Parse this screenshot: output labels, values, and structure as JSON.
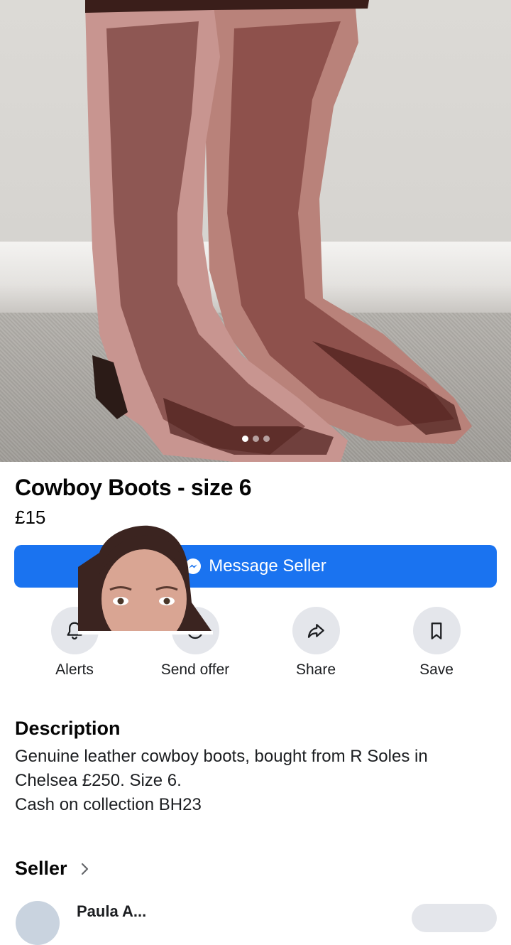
{
  "listing": {
    "title": "Cowboy Boots - size 6",
    "price": "£15"
  },
  "carousel": {
    "image_count": 3,
    "active_index": 0,
    "image_subject": "pair of pink and brown leather cowboy boots with eagle design"
  },
  "primary_action": {
    "label": "Message Seller",
    "icon": "messenger-icon",
    "color": "#1a73f0"
  },
  "actions": [
    {
      "label": "Alerts",
      "icon": "bell-icon"
    },
    {
      "label": "Send offer",
      "icon": "offer-icon"
    },
    {
      "label": "Share",
      "icon": "share-arrow-icon"
    },
    {
      "label": "Save",
      "icon": "bookmark-icon"
    }
  ],
  "description": {
    "heading": "Description",
    "lines": [
      "Genuine leather cowboy boots, bought from R Soles in Chelsea £250. Size 6.",
      "Cash on collection BH23"
    ]
  },
  "seller": {
    "heading": "Seller",
    "name": "Paula A..."
  }
}
